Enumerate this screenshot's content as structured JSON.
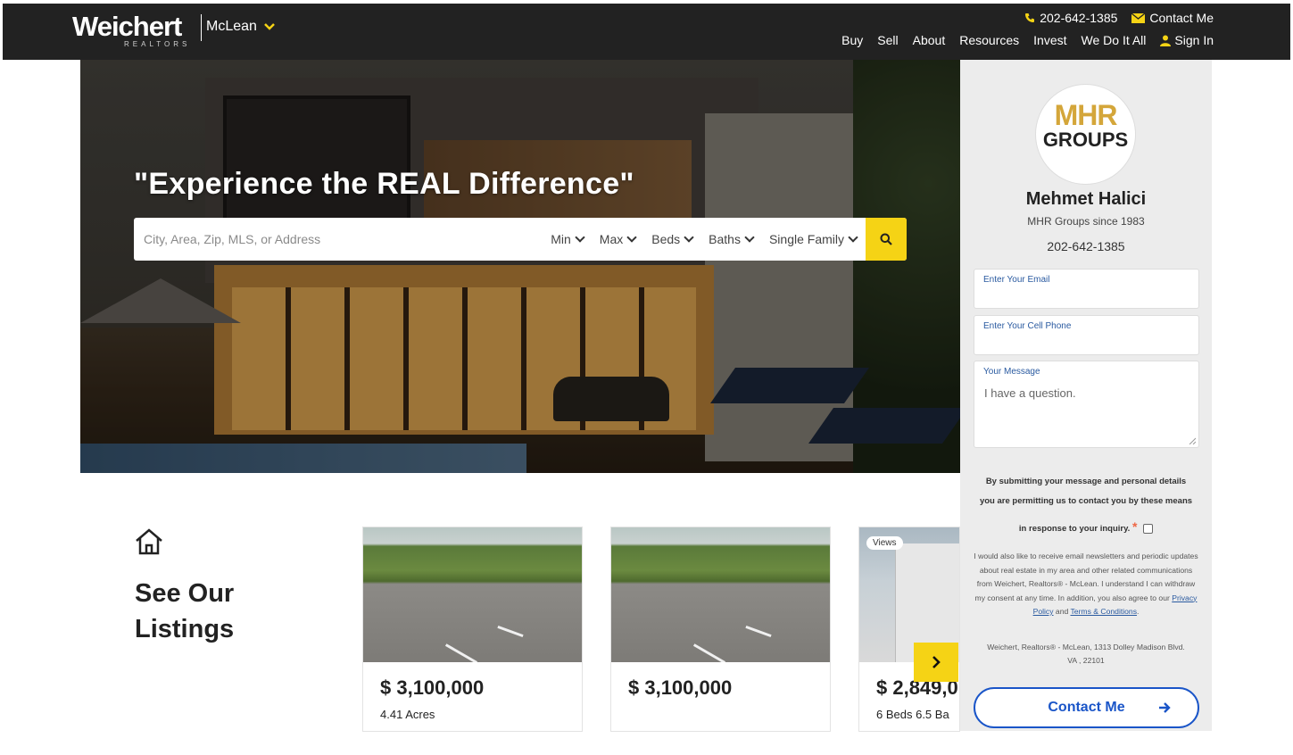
{
  "header": {
    "logo_text": "Weichert",
    "logo_subtext": "REALTORS",
    "office": "McLean",
    "phone": "202-642-1385",
    "contact_label": "Contact Me",
    "nav": [
      "Buy",
      "Sell",
      "About",
      "Resources",
      "Invest",
      "We Do It All"
    ],
    "sign_in": "Sign In"
  },
  "hero": {
    "headline": "\"Experience the REAL Difference\"",
    "search_placeholder": "City, Area, Zip, MLS, or Address",
    "filters": [
      "Min",
      "Max",
      "Beds",
      "Baths",
      "Single Family"
    ]
  },
  "agent": {
    "logo_top": "MHR",
    "logo_bottom": "GROUPS",
    "name": "Mehmet Halici",
    "since": "MHR Groups since 1983",
    "phone": "202-642-1385",
    "email_label": "Enter Your Email",
    "cell_label": "Enter Your Cell Phone",
    "message_label": "Your Message",
    "message_value": "I have a question.",
    "disclaimer_1": "By submitting your message and personal details",
    "disclaimer_2": "you are permitting us to contact you by these means",
    "disclaimer_3": "in response to your inquiry.",
    "consent_text": "I would also like to receive email newsletters and periodic updates about real estate in my area and other related communications from Weichert, Realtors® - McLean. I understand I can withdraw my consent at any time. In addition, you also agree to our",
    "privacy_link": "Privacy Policy",
    "and": "and",
    "terms_link": "Terms & Conditions",
    "address_line1": "Weichert, Realtors® - McLean, 1313 Dolley Madison Blvd.",
    "address_line2": "VA , 22101",
    "contact_button": "Contact Me"
  },
  "listings": {
    "title_line1": "See Our",
    "title_line2": "Listings",
    "cards": [
      {
        "price": "$ 3,100,000",
        "detail": "4.41 Acres",
        "badge": ""
      },
      {
        "price": "$ 3,100,000",
        "detail": "",
        "badge": ""
      },
      {
        "price": "$ 2,849,0",
        "detail": "6 Beds 6.5 Ba",
        "badge": "Views"
      }
    ]
  }
}
